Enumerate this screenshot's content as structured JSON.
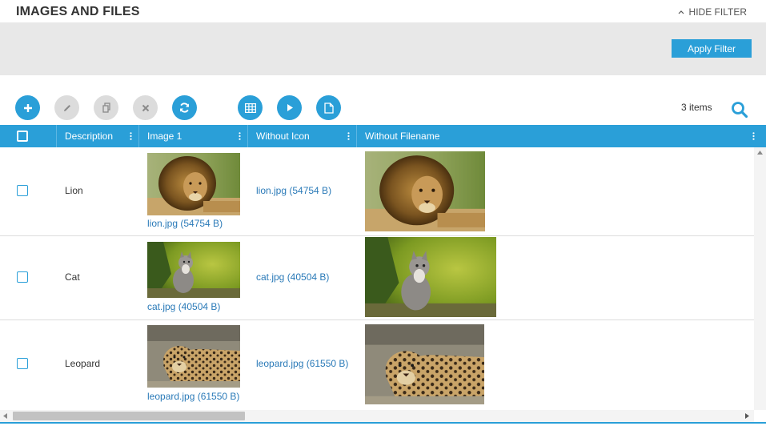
{
  "header": {
    "title": "IMAGES AND FILES",
    "hide_filter_label": "HIDE FILTER"
  },
  "filter": {
    "apply_label": "Apply Filter"
  },
  "toolbar": {
    "buttons": [
      {
        "name": "add",
        "icon": "plus-icon",
        "state": "active"
      },
      {
        "name": "edit",
        "icon": "pencil-icon",
        "state": "disabled"
      },
      {
        "name": "copy",
        "icon": "copy-icon",
        "state": "disabled"
      },
      {
        "name": "delete",
        "icon": "close-icon",
        "state": "disabled"
      },
      {
        "name": "refresh",
        "icon": "refresh-icon",
        "state": "active"
      },
      {
        "name": "grid-view",
        "icon": "table-icon",
        "state": "active"
      },
      {
        "name": "play",
        "icon": "play-icon",
        "state": "active"
      },
      {
        "name": "document",
        "icon": "document-icon",
        "state": "active"
      }
    ],
    "items_count": "3 items"
  },
  "grid": {
    "columns": [
      "Description",
      "Image 1",
      "Without Icon",
      "Without Filename"
    ],
    "rows": [
      {
        "description": "Lion",
        "image_link": "lion.jpg (54754 B)",
        "without_icon": "lion.jpg (54754 B)",
        "thumb": "lion"
      },
      {
        "description": "Cat",
        "image_link": "cat.jpg (40504 B)",
        "without_icon": "cat.jpg (40504 B)",
        "thumb": "cat"
      },
      {
        "description": "Leopard",
        "image_link": "leopard.jpg (61550 B)",
        "without_icon": "leopard.jpg (61550 B)",
        "thumb": "leopard"
      }
    ]
  },
  "colors": {
    "accent": "#2a9fd8",
    "disabled": "#dcdcdc",
    "filter_bg": "#e8e8e8",
    "link": "#2a7ab8"
  }
}
